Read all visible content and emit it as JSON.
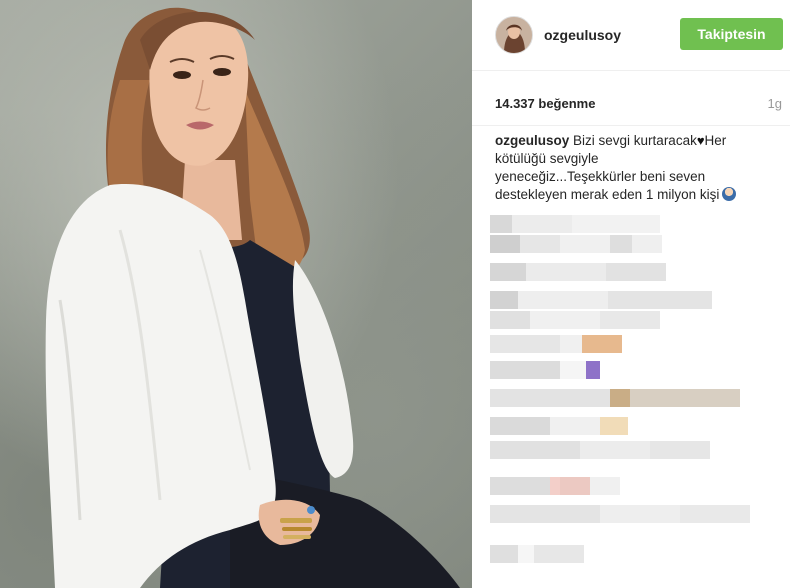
{
  "post": {
    "username": "ozgeulusoy",
    "follow_label": "Takiptesin",
    "likes": "14.337 beğenme",
    "time": "1g",
    "caption_user": "ozgeulusoy",
    "caption_part1": "Bizi sevgi kurtaracak",
    "caption_part2": "Her",
    "caption_line2": "kötülüğü sevgiyle",
    "caption_line3": "yeneceğiz...Teşekkürler beni seven",
    "caption_line4": "destekleyen merak eden 1 milyon kişi",
    "heart_icon": "♥",
    "emoji_icon": "person-emoji-icon"
  },
  "colors": {
    "follow_button": "#70c050",
    "divider": "#efefef"
  },
  "comments": {
    "state": "pixelated"
  }
}
